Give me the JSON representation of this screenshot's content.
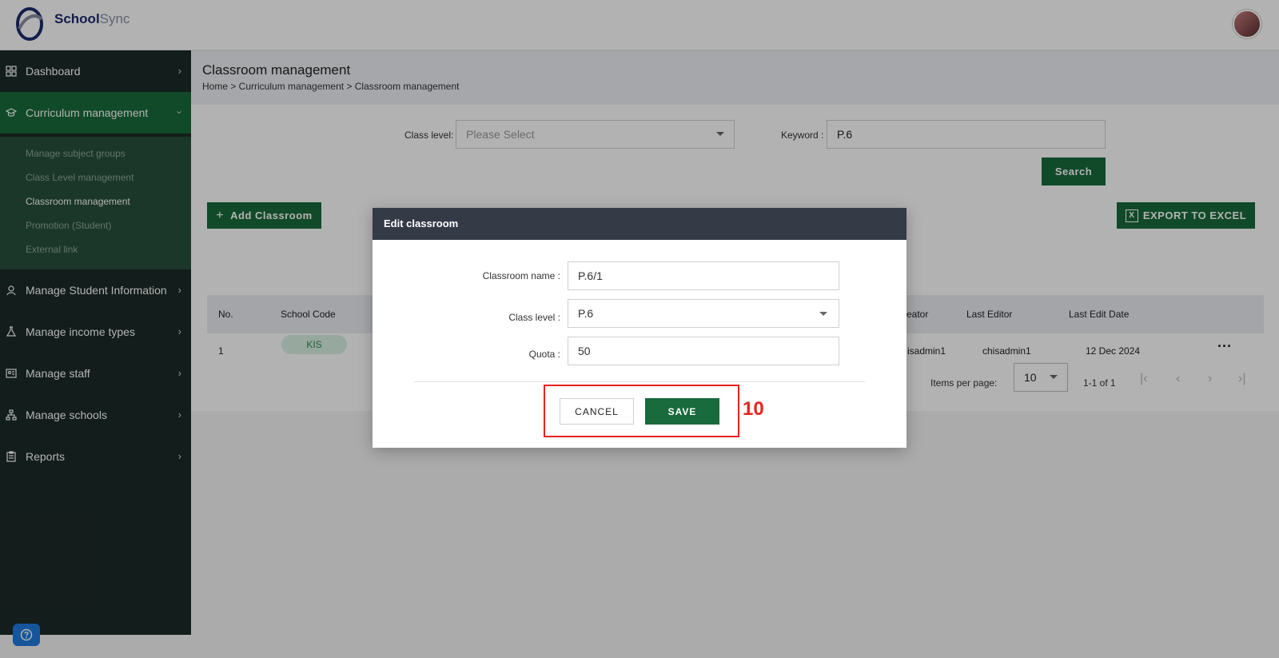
{
  "app": {
    "brand_primary": "School",
    "brand_secondary": "Sync"
  },
  "sidebar": {
    "items": [
      {
        "label": "Dashboard",
        "icon": "grid-icon"
      },
      {
        "label": "Curriculum management",
        "icon": "graduation-cap-icon"
      },
      {
        "label": "Manage Student Information",
        "icon": "student-icon"
      },
      {
        "label": "Manage income types",
        "icon": "flask-icon"
      },
      {
        "label": "Manage staff",
        "icon": "staff-board-icon"
      },
      {
        "label": "Manage schools",
        "icon": "schools-hierarchy-icon"
      },
      {
        "label": "Reports",
        "icon": "clipboard-icon"
      }
    ],
    "submenu": [
      {
        "label": "Manage subject groups"
      },
      {
        "label": "Class Level management"
      },
      {
        "label": "Classroom management"
      },
      {
        "label": "Promotion (Student)"
      },
      {
        "label": "External link"
      }
    ]
  },
  "page": {
    "title": "Classroom management",
    "breadcrumb": "Home > Curriculum management > Classroom management"
  },
  "filters": {
    "class_level_label": "Class level:",
    "class_level_placeholder": "Please Select",
    "keyword_label": "Keyword :",
    "keyword_value": "P.6",
    "search_label": "Search"
  },
  "toolbar": {
    "add_label": "Add Classroom",
    "export_label": "EXPORT TO EXCEL"
  },
  "table": {
    "headers": {
      "no": "No.",
      "school_code": "School Code",
      "creator": "eator",
      "last_editor": "Last Editor",
      "last_edit_date": "Last Edit Date"
    },
    "rows": [
      {
        "no": "1",
        "school_code": "KIS",
        "creator": "isadmin1",
        "last_editor": "chisadmin1",
        "last_edit_date": "12 Dec 2024"
      }
    ]
  },
  "pagination": {
    "items_per_page_label": "Items per page:",
    "items_per_page": "10",
    "range": "1-1 of 1"
  },
  "modal": {
    "title": "Edit classroom",
    "classroom_name_label": "Classroom name :",
    "classroom_name_value": "P.6/1",
    "class_level_label": "Class level :",
    "class_level_value": "P.6",
    "quota_label": "Quota :",
    "quota_value": "50",
    "cancel_label": "CANCEL",
    "save_label": "SAVE"
  },
  "annotation": {
    "step": "10"
  },
  "colors": {
    "brand_green": "#196a3c",
    "sidebar_bg": "#1c2a27",
    "highlight_red": "#e8231e"
  }
}
